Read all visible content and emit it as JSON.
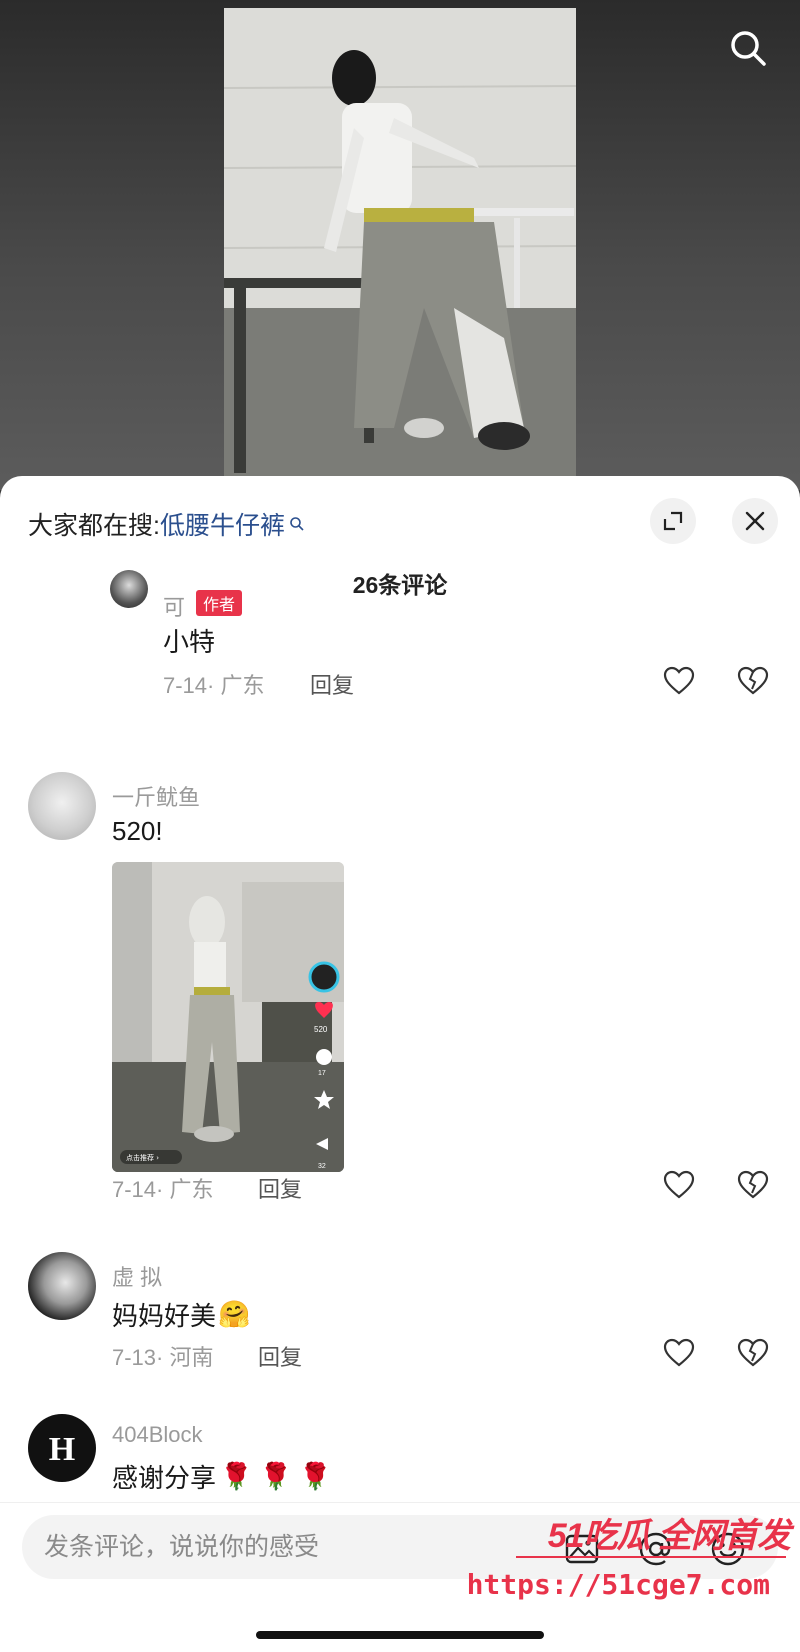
{
  "video": {
    "search_icon": "search-icon"
  },
  "sheet": {
    "search_hint_prefix": "大家都在搜:",
    "search_hint_term": "低腰牛仔裤",
    "comment_count_title": "26条评论"
  },
  "comments": [
    {
      "username": "可",
      "badge": "作者",
      "text": "小特",
      "date_location": "7-14· 广东",
      "reply": "回复"
    },
    {
      "username": "一斤鱿鱼",
      "text": "520!",
      "date_location": "7-14· 广东",
      "reply": "回复",
      "media": {
        "stat_like_count": "520",
        "stat_comment_count": "17",
        "stat_share_count": "32",
        "bottom_tag": "点击推荐"
      }
    },
    {
      "username": "虚 拟",
      "text": "妈妈好美",
      "emoji": "🤗",
      "date_location": "7-13· 河南",
      "reply": "回复"
    },
    {
      "username": "404Block",
      "text": "感谢分享",
      "emoji": "🌹 🌹 🌹"
    }
  ],
  "input": {
    "placeholder": "发条评论，说说你的感受"
  },
  "watermark": {
    "line1": "51吃瓜 全网首发",
    "line2": "https://51cge7.com"
  },
  "colors": {
    "accent_link": "#2b4f8e",
    "badge_red": "#e8334a",
    "watermark_red": "#e8334a"
  }
}
